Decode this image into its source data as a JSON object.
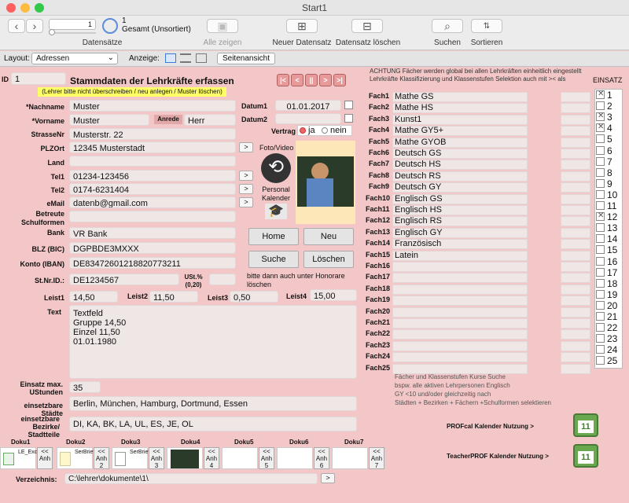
{
  "window": {
    "title": "Start1"
  },
  "toolbar": {
    "record_value": "1",
    "record_info": "1",
    "record_status": "Gesamt (Unsortiert)",
    "datensaetze": "Datensätze",
    "alle_zeigen": "Alle zeigen",
    "neuer": "Neuer Datensatz",
    "loeschen": "Datensatz löschen",
    "suchen": "Suchen",
    "sortieren": "Sortieren"
  },
  "layoutbar": {
    "layout_label": "Layout:",
    "layout_value": "Adressen",
    "anzeige": "Anzeige:",
    "seitenansicht": "Seitenansicht"
  },
  "header": {
    "id_label": "ID",
    "id_value": "1",
    "title": "Stammdaten der Lehrkräfte erfassen",
    "notice": "(Lehrer bitte nicht überschreiben / neu anlegen / Muster löschen)"
  },
  "nav": [
    "|<",
    "<",
    "||",
    ">",
    ">|"
  ],
  "person": {
    "nachname_label": "*Nachname",
    "nachname": "Muster",
    "vorname_label": "*Vorname",
    "vorname": "Muster",
    "anrede_label": "Anrede",
    "anrede": "Herr",
    "strasse_label": "StrasseNr",
    "strasse": "Musterstr. 22",
    "plzort_label": "PLZOrt",
    "plzort": "12345 Musterstadt",
    "land_label": "Land",
    "land": "",
    "tel1_label": "Tel1",
    "tel1": "01234-123456",
    "tel2_label": "Tel2",
    "tel2": "0174-6231404",
    "email_label": "eMail",
    "email": "datenb@gmail.com",
    "schulform_label": "Betreute Schulformen",
    "schulform": "",
    "bank_label": "Bank",
    "bank": "VR Bank",
    "bic_label": "BLZ (BIC)",
    "bic": "DGPBDE3MXXX",
    "iban_label": "Konto (IBAN)",
    "iban": "DE83472601218820773211",
    "stnr_label": "St.Nr.ID.:",
    "stnr": "DE1234567",
    "ust_label": "USt.% (0,20)",
    "ust": "",
    "honorar_note": "bitte dann auch unter Honorare löschen",
    "leist1_label": "Leist1",
    "leist1": "14,50",
    "leist2_label": "Leist2",
    "leist2": "11,50",
    "leist3_label": "Leist3",
    "leist3": "0,50",
    "leist4_label": "Leist4",
    "leist4": "15,00",
    "text_label": "Text",
    "text_lines": [
      "Textfeld",
      "Gruppe 14,50",
      "Einzel 11,50",
      "01.01.1980"
    ],
    "einsatz_max_label": "Einsatz max. UStunden",
    "einsatz_max": "35",
    "staedte_label": "einsetzbare Städte",
    "staedte": "Berlin, München, Hamburg, Dortmund, Essen",
    "bezirke_label": "einsetzbare Bezirke/ Stadtteile",
    "bezirke": "DI, KA, BK, LA, UL, ES, JE, OL"
  },
  "dates": {
    "datum1_label": "Datum1",
    "datum1": "01.01.2017",
    "datum2_label": "Datum2",
    "datum2": "",
    "vertrag_label": "Vertrag",
    "ja": "ja",
    "nein": "nein"
  },
  "media": {
    "foto_label": "Foto/Video",
    "kalender_label": "Personal Kalender"
  },
  "buttons": {
    "home": "Home",
    "neu": "Neu",
    "suche": "Suche",
    "loeschen": "Löschen",
    "go": ">"
  },
  "faecher": {
    "notice": "ACHTUNG Fächer werden global bei allen Lehrkräften einheitlich eingestellt Lehrkräfte Klassifizierung und Klassenstufen Selektion auch mit >< als",
    "einsatz_label": "EINSATZ",
    "rows": [
      {
        "label": "Fach1",
        "value": "Mathe GS"
      },
      {
        "label": "Fach2",
        "value": "Mathe HS"
      },
      {
        "label": "Fach3",
        "value": "Kunst1"
      },
      {
        "label": "Fach4",
        "value": "Mathe GY5+"
      },
      {
        "label": "Fach5",
        "value": "Mathe GYOB"
      },
      {
        "label": "Fach6",
        "value": "Deutsch GS"
      },
      {
        "label": "Fach7",
        "value": "Deutsch HS"
      },
      {
        "label": "Fach8",
        "value": "Deutsch RS"
      },
      {
        "label": "Fach9",
        "value": "Deutsch GY"
      },
      {
        "label": "Fach10",
        "value": "Englisch GS"
      },
      {
        "label": "Fach11",
        "value": "Englisch HS"
      },
      {
        "label": "Fach12",
        "value": "Englisch RS"
      },
      {
        "label": "Fach13",
        "value": "Englisch GY"
      },
      {
        "label": "Fach14",
        "value": "Französisch"
      },
      {
        "label": "Fach15",
        "value": "Latein"
      },
      {
        "label": "Fach16",
        "value": ""
      },
      {
        "label": "Fach17",
        "value": ""
      },
      {
        "label": "Fach18",
        "value": ""
      },
      {
        "label": "Fach19",
        "value": ""
      },
      {
        "label": "Fach20",
        "value": ""
      },
      {
        "label": "Fach21",
        "value": ""
      },
      {
        "label": "Fach22",
        "value": ""
      },
      {
        "label": "Fach23",
        "value": ""
      },
      {
        "label": "Fach24",
        "value": ""
      },
      {
        "label": "Fach25",
        "value": ""
      }
    ],
    "einsatz": [
      {
        "num": "1",
        "checked": true
      },
      {
        "num": "2",
        "checked": false
      },
      {
        "num": "3",
        "checked": true
      },
      {
        "num": "4",
        "checked": true
      },
      {
        "num": "5",
        "checked": false
      },
      {
        "num": "6",
        "checked": false
      },
      {
        "num": "7",
        "checked": false
      },
      {
        "num": "8",
        "checked": false
      },
      {
        "num": "9",
        "checked": false
      },
      {
        "num": "10",
        "checked": false
      },
      {
        "num": "11",
        "checked": false
      },
      {
        "num": "12",
        "checked": true
      },
      {
        "num": "13",
        "checked": false
      },
      {
        "num": "14",
        "checked": false
      },
      {
        "num": "15",
        "checked": false
      },
      {
        "num": "16",
        "checked": false
      },
      {
        "num": "17",
        "checked": false
      },
      {
        "num": "18",
        "checked": false
      },
      {
        "num": "19",
        "checked": false
      },
      {
        "num": "20",
        "checked": false
      },
      {
        "num": "21",
        "checked": false
      },
      {
        "num": "22",
        "checked": false
      },
      {
        "num": "23",
        "checked": false
      },
      {
        "num": "24",
        "checked": false
      },
      {
        "num": "25",
        "checked": false
      }
    ],
    "hint_lines": [
      "Fächer und Klassenstufen Kurse Suche",
      "bspw. alle aktiven Lehrpersonen Englisch",
      "GY <10 und/oder gleichzeitig nach",
      "Städten + Bezirken + Fächern +Schulformen selektieren"
    ],
    "profcal": "PROFcal Kalender Nutzung >",
    "teacherprof": "TeacherPROF Kalender Nutzung >",
    "cal_day": "11"
  },
  "doku": {
    "labels": [
      "Doku1",
      "Doku2",
      "Doku3",
      "Doku4",
      "Doku5",
      "Doku6",
      "Doku7"
    ],
    "files": [
      "LE_Excel.xls",
      "SerBrief.tab",
      "SerBrief.mer",
      "",
      "",
      "",
      ""
    ],
    "anh": [
      "<< Anh",
      "<< Anh 2",
      "<< Anh 3",
      "<< Anh 4",
      "<< Anh 5",
      "<< Anh 6",
      "<< Anh 7"
    ],
    "verzeichnis_label": "Verzeichnis:",
    "verzeichnis": "C:\\lehrer\\dokumente\\1\\"
  },
  "colors": {
    "background": "#f3c7c7",
    "field": "#efe6e6",
    "accent": "#e89a9a",
    "notice": "#ffff66",
    "calendar": "#6aa84f"
  }
}
